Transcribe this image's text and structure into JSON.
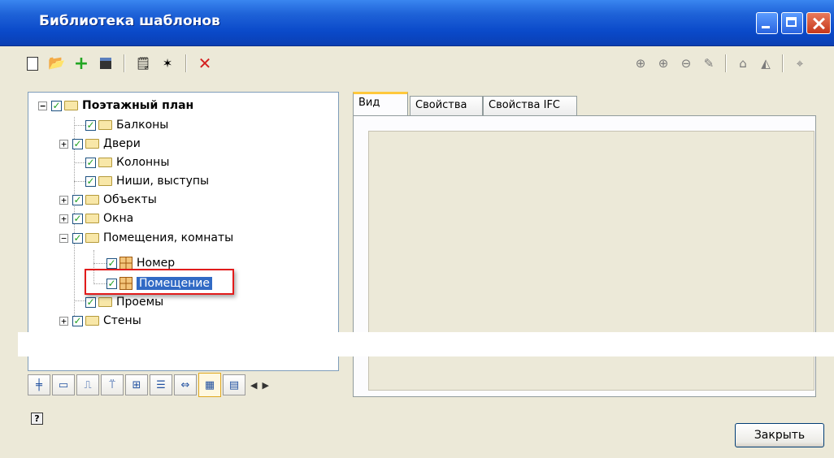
{
  "window": {
    "title": "Библиотека шаблонов"
  },
  "toolbar": {
    "icons": [
      "new-icon",
      "open-icon",
      "add-icon",
      "save-icon",
      "new-template-icon",
      "clone-icon",
      "delete-icon"
    ]
  },
  "view_toolbar": {
    "icons": [
      "zoom-extents-icon",
      "zoom-in-icon",
      "zoom-out-icon",
      "pan-icon",
      "rotate-icon",
      "mirror-icon",
      "center-icon"
    ]
  },
  "tree": {
    "root": "Поэтажный план",
    "items": [
      {
        "label": "Балконы"
      },
      {
        "label": "Двери"
      },
      {
        "label": "Колонны"
      },
      {
        "label": "Ниши, выступы"
      },
      {
        "label": "Объекты"
      },
      {
        "label": "Окна"
      },
      {
        "label": "Помещения, комнаты"
      },
      {
        "label": "Номер"
      },
      {
        "label": "Помещение"
      },
      {
        "label": "Проемы"
      },
      {
        "label": "Стены"
      }
    ]
  },
  "tabs": [
    {
      "label": "Вид"
    },
    {
      "label": "Свойства"
    },
    {
      "label": "Свойства IFC"
    }
  ],
  "footer": {
    "close_label": "Закрыть",
    "help": "?"
  }
}
